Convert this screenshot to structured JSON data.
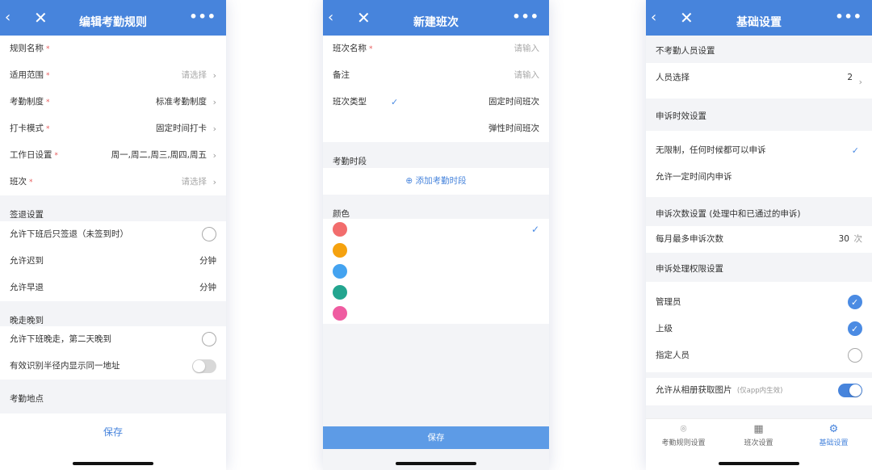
{
  "colors": {
    "nav": "#4784dc",
    "accent": "#4b8be3",
    "required": "#e65b5b"
  },
  "icons": {
    "back": "‹",
    "close": "✕",
    "more": "•••",
    "chevron": "›",
    "check": "✓",
    "add": "⊕",
    "location": "⌾",
    "calendar": "▦",
    "gear": "⚙"
  },
  "screen1": {
    "title": "编辑考勤规则",
    "rows": [
      {
        "label": "规则名称",
        "value": ""
      },
      {
        "label": "适用范围",
        "value": "请选择"
      },
      {
        "label": "考勤制度",
        "value": "标准考勤制度"
      },
      {
        "label": "打卡模式",
        "value": "固定时间打卡"
      },
      {
        "label": "工作日设置",
        "value": "周一,周二,周三,周四,周五"
      },
      {
        "label": "班次",
        "value": "请选择"
      }
    ],
    "required_mark": "*",
    "sign_out_section": "签退设置",
    "sign_out_only": "允许下班后只签退（未签到时）",
    "late_label": "允许迟到",
    "late_unit": "分钟",
    "early_label": "允许早退",
    "early_unit": "分钟",
    "late_night_section": "晚走晚到",
    "late_night_row": "允许下班晚走，第二天晚到",
    "radius_row": "有效识别半径内显示同一地址",
    "radius_toggle_on": false,
    "location_section": "考勤地点",
    "save": "保存"
  },
  "screen2": {
    "title": "新建班次",
    "name_label": "班次名称",
    "name_placeholder": "请输入",
    "note_label": "备注",
    "note_placeholder": "请输入",
    "type_label": "班次类型",
    "type_fixed": "固定时间班次",
    "type_flex": "弹性时间班次",
    "period_section": "考勤时段",
    "add_period": "添加考勤时段",
    "color_section": "颜色",
    "swatches": [
      "#f26d6d",
      "#f5a20f",
      "#44a3f0",
      "#23a58f",
      "#ef5ca1"
    ],
    "selected_swatch": 0,
    "save": "保存"
  },
  "screen3": {
    "title": "基础设置",
    "exempt_section": "不考勤人员设置",
    "people_label": "人员选择",
    "people_count": "2",
    "appeal_time_section": "申诉时效设置",
    "appeal_unlimited": "无限制，任何时候都可以申诉",
    "appeal_limited": "允许一定时间内申诉",
    "appeal_count_section": "申诉次数设置 (处理中和已通过的申诉)",
    "monthly_max_label": "每月最多申诉次数",
    "monthly_max_value": "30",
    "monthly_max_unit": "次",
    "permission_section": "申诉处理权限设置",
    "roles": [
      {
        "label": "管理员",
        "checked": true
      },
      {
        "label": "上级",
        "checked": true
      },
      {
        "label": "指定人员",
        "checked": false
      }
    ],
    "album_label": "允许从相册获取图片",
    "album_hint": "(仅app内生效)",
    "album_toggle_on": true,
    "tabs": [
      {
        "label": "考勤规则设置",
        "icon": "location"
      },
      {
        "label": "班次设置",
        "icon": "calendar"
      },
      {
        "label": "基础设置",
        "icon": "gear"
      }
    ],
    "active_tab": 2
  }
}
